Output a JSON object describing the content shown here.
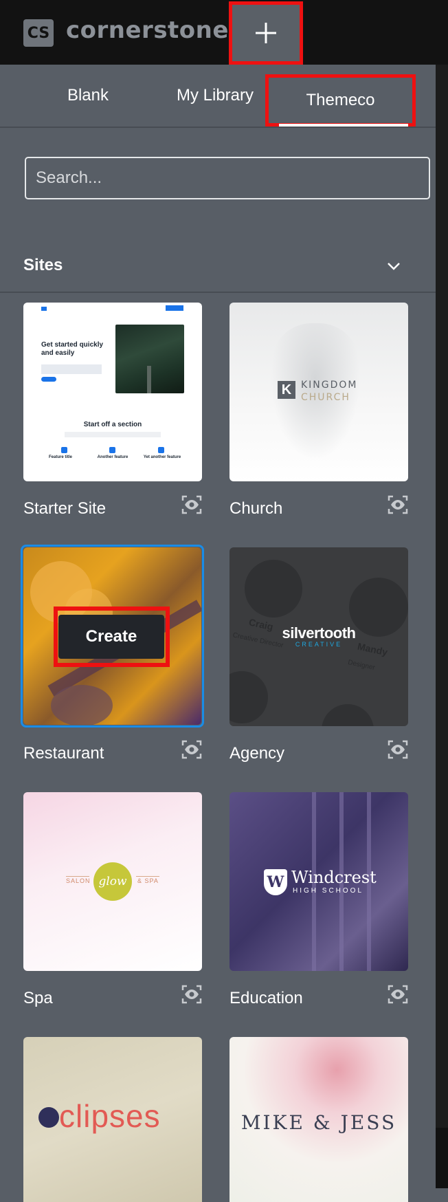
{
  "app": {
    "logo_mark": "CS",
    "logo_text": "cornerstone"
  },
  "tabs": [
    {
      "label": "Blank"
    },
    {
      "label": "My Library"
    },
    {
      "label": "Themeco",
      "active": true
    }
  ],
  "search": {
    "placeholder": "Search..."
  },
  "section": {
    "title": "Sites"
  },
  "sites": [
    {
      "name": "Starter Site",
      "thumbnail_text": {
        "headline": "Get started quickly and easily",
        "section": "Start off a section",
        "features": [
          "Feature title",
          "Another feature",
          "Yet another feature"
        ]
      }
    },
    {
      "name": "Church",
      "thumbnail_text": {
        "logo_line1": "KINGDOM",
        "logo_line2": "CHURCH"
      }
    },
    {
      "name": "Restaurant",
      "selected": true,
      "hover_action": "Create"
    },
    {
      "name": "Agency",
      "thumbnail_text": {
        "logo": "silvertooth",
        "sub": "CREATIVE",
        "bg_words": [
          "Craig",
          "Creative Director",
          "Mandy",
          "Designer"
        ]
      }
    },
    {
      "name": "Spa",
      "thumbnail_text": {
        "left": "SALON",
        "center": "glow",
        "right": "& SPA"
      }
    },
    {
      "name": "Education",
      "thumbnail_text": {
        "line1": "Windcrest",
        "line2": "HIGH SCHOOL"
      }
    },
    {
      "name": "",
      "thumbnail_text": {
        "logo": "clipses"
      }
    },
    {
      "name": "",
      "thumbnail_text": {
        "logo": "MIKE & JESS"
      }
    }
  ],
  "colors": {
    "accent_blue": "#1a8ce6",
    "highlight_red": "#ee1111",
    "panel_bg": "#585e66"
  }
}
